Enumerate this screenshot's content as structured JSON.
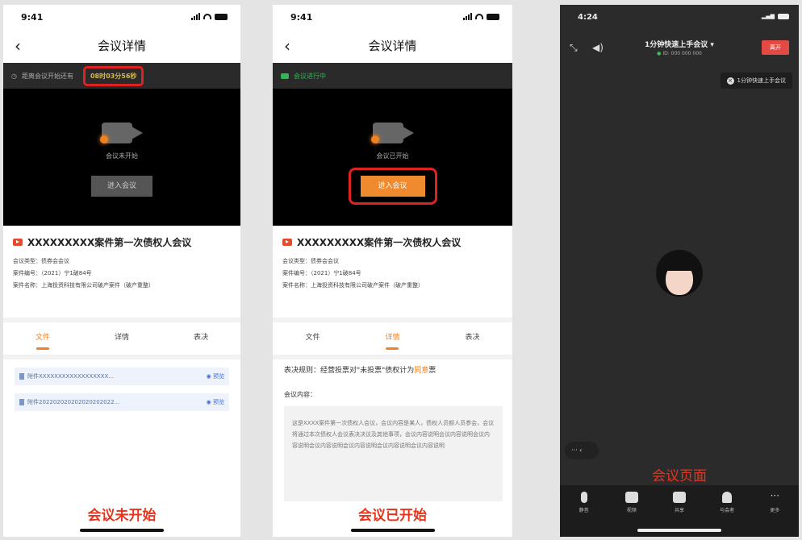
{
  "phone1": {
    "time": "9:41",
    "nav_title": "会议详情",
    "countdown_label": "距离会议开始还有",
    "countdown_value": "08时03分56秒",
    "video_status": "会议未开始",
    "join_label": "进入会议",
    "meeting_title": "XXXXXXXXX案件第一次债权人会议",
    "type_row": "会议类型：债券会会议",
    "case_no_row": "案件编号：（2021）宁1破84号",
    "case_name_row": "案件名称：上海投资科技有限公司破产案件（破产重整）",
    "tabs": [
      "文件",
      "详情",
      "表决"
    ],
    "active_tab": 0,
    "files": [
      {
        "name": "附件XXXXXXXXXXXXXXXXXX...",
        "action": "预览"
      },
      {
        "name": "附件202202020202020202022...",
        "action": "预览"
      }
    ],
    "caption": "会议未开始"
  },
  "phone2": {
    "time": "9:41",
    "nav_title": "会议详情",
    "live_label": "会议进行中",
    "video_status": "会议已开始",
    "join_label": "进入会议",
    "meeting_title": "XXXXXXXXX案件第一次债权人会议",
    "type_row": "会议类型：债券会会议",
    "case_no_row": "案件编号：（2021）宁1破84号",
    "case_name_row": "案件名称：上海投资科技有限公司破产案件（破产重整）",
    "tabs": [
      "文件",
      "详情",
      "表决"
    ],
    "active_tab": 1,
    "rule_prefix": "表决规则：经营投票对\"未投票\"债权计为",
    "rule_highlight": "同意",
    "rule_suffix": "票",
    "content_label": "会议内容：",
    "content_text": "这是XXXX案件第一次债权人会议，会议内容是某人，债权人员额人员参会，会议将通过本次债权人会议表决决议及其他事项，会议内容说明会议内容说明会议内容说明会议内容说明会议内容说明会议内容说明会议内容说明",
    "caption": "会议已开始"
  },
  "phone3": {
    "time": "4:24",
    "meeting_title": "1分钟快速上手会议 ▾",
    "meeting_id": "ID: 000 000 000",
    "leave_label": "离开",
    "pill_label": "1分钟快速上手会议",
    "chat_label": "··· ‹",
    "caption": "会议页面",
    "tools": [
      "静音",
      "视频",
      "共享",
      "与会者",
      "更多"
    ]
  }
}
